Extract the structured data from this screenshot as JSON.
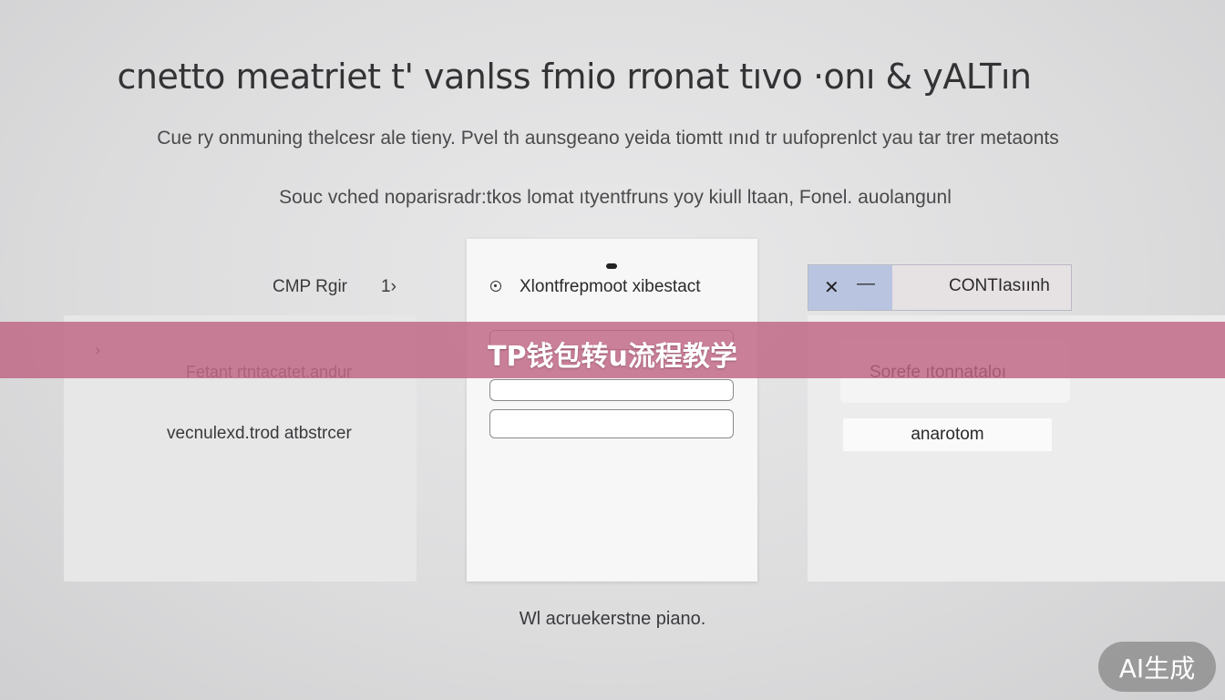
{
  "header": {
    "title": "cnetto meatriet t' vanlss fmio rronat tıvo ·onı & yALTın",
    "subtitle": "Cue ry onmuning thelcesr ale tieny. Pvel th aunsgeano yeida tiomtt ınıd tr uufoprenlct yau tar trer metaonts",
    "subtitle2": "Souc vched noparisradr:tkos lomat ıtyentfruns yoy kiull ltaan, Fonel. auolangunl"
  },
  "left_panel": {
    "label": "CMP Rgir",
    "count": "1›",
    "arrow": "›",
    "row1": "Fetant rtntacatet.andur",
    "row2": "vecnulexd.trod atbstrcer"
  },
  "middle_panel": {
    "heading": "Xlontfrepmoot xibestact"
  },
  "right_panel": {
    "close_glyph": "✕",
    "minus_glyph": "—",
    "toolbar_label": "CONTIasıınh",
    "box1_text": "Sorefe ıtonnataloı",
    "box2_text": "anarotom"
  },
  "footer": {
    "text": "Wl acruekerstne piano."
  },
  "overlay": {
    "banner_text": "TP钱包转u流程教学",
    "badge_text": "AI生成"
  },
  "colors": {
    "banner": "#c06482",
    "toolbar_accent": "#b9c5e0"
  },
  "icons": [
    "radio-icon",
    "close-icon",
    "minus-icon",
    "chevron-right-icon"
  ]
}
